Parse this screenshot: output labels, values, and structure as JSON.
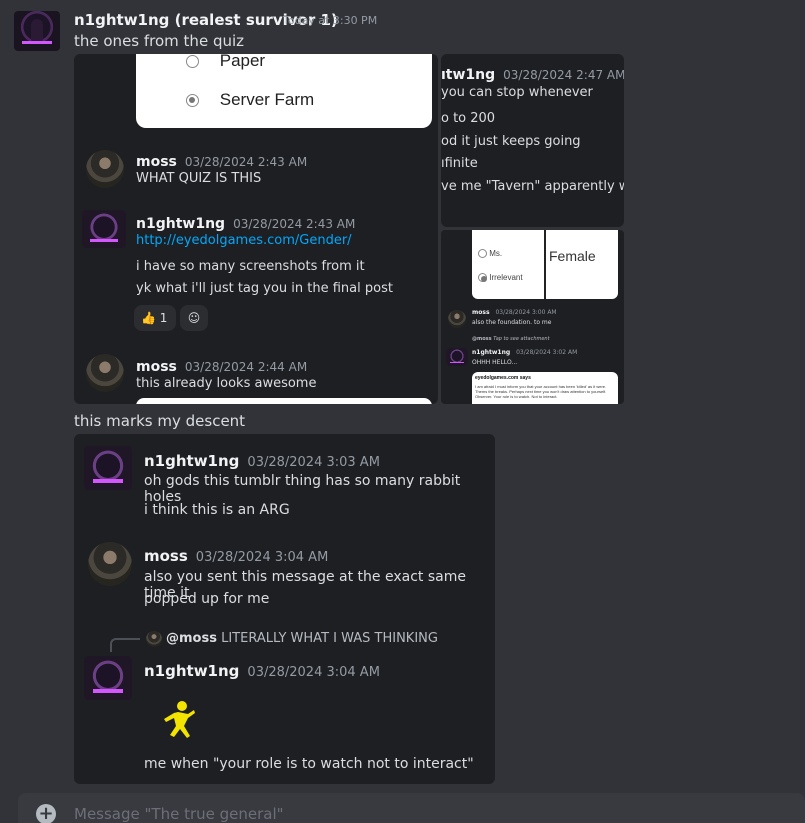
{
  "message": {
    "username": "n1ghtw1ng (realest survivor 1)",
    "timestamp": "Today at 3:30 PM",
    "line1": "the ones from the quiz",
    "line2": "this marks my descent"
  },
  "shot1": {
    "options": [
      "Paper",
      "Server Farm"
    ],
    "msgs": [
      {
        "name": "moss",
        "time": "03/28/2024 2:43 AM",
        "lines": [
          "WHAT QUIZ IS THIS"
        ]
      },
      {
        "name": "n1ghtw1ng",
        "time": "03/28/2024 2:43 AM",
        "link": "http://eyedolgames.com/Gender/",
        "lines": [
          "i have so many screenshots from it",
          "yk what i'll just tag you in the final post"
        ]
      },
      {
        "name": "moss",
        "time": "03/28/2024 2:44 AM",
        "lines": [
          "this already looks awesome"
        ]
      }
    ],
    "reaction_count": "1"
  },
  "shot2": {
    "name": "ıtw1ng",
    "time": "03/28/2024 2:47 AM",
    "lines": [
      "you can stop whenever",
      "o to 200",
      "od it just keeps going",
      "ıfinite",
      "ve me \"Tavern\" apparently what"
    ]
  },
  "shot3": {
    "options": [
      "Ms.",
      "Irrelevant"
    ],
    "female": "Female",
    "moss_name": "moss",
    "moss_time": "03/28/2024 3:00 AM",
    "moss_text": "also the foundation. to me",
    "reply_mention": "@moss",
    "reply_text": "Tap to see attachment",
    "n_name": "n1ghtw1ng",
    "n_time": "03/28/2024 3:02 AM",
    "n_text": "OHHH HELLO...",
    "site": "eyedolgames.com says",
    "popup": "I am afraid I must inform you that your account has been 'killed' as it were. Thems the breaks. Perhaps next time you won't draw attention to yourself. Observer. Your role is to watch. Not to interact."
  },
  "shot4": {
    "m1": {
      "name": "n1ghtw1ng",
      "time": "03/28/2024 3:03 AM",
      "lines": [
        "oh gods this tumblr thing has so many rabbit holes",
        "i think this is an ARG"
      ]
    },
    "m2": {
      "name": "moss",
      "time": "03/28/2024 3:04 AM",
      "lines": [
        "also you sent this message at the exact same time it",
        "popped up for me"
      ]
    },
    "reply": {
      "mention": "@moss",
      "text": "LITERALLY WHAT I WAS THINKING"
    },
    "m3": {
      "name": "n1ghtw1ng",
      "time": "03/28/2024 3:04 AM",
      "caption": "me when \"your role is to watch not to interact\""
    }
  },
  "input": {
    "placeholder": "Message \"The true general\""
  },
  "colors": {
    "link": "#00a8fc",
    "accent": "#d356ff",
    "bg": "#313338",
    "card": "#1e1f22"
  }
}
